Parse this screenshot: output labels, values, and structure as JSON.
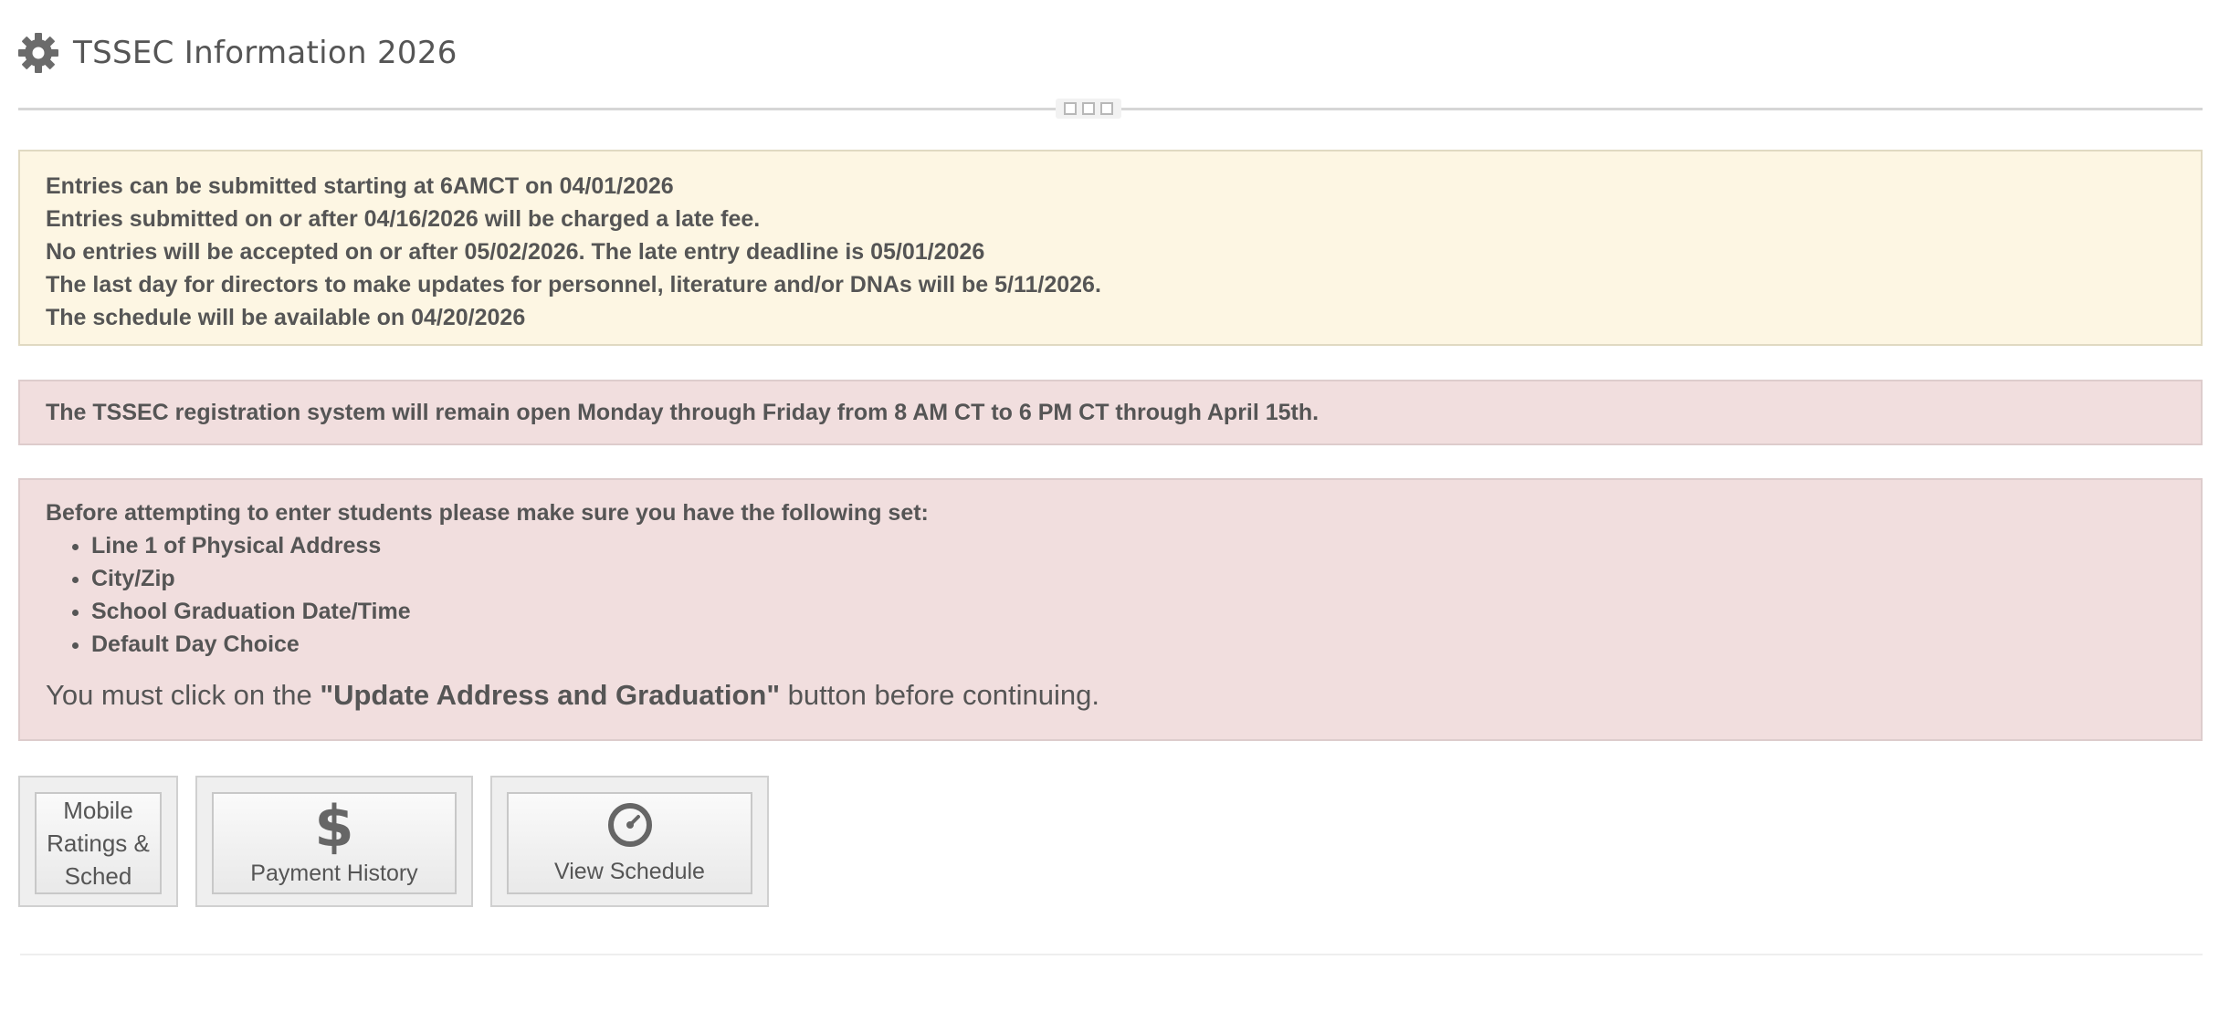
{
  "header": {
    "title": "TSSEC Information 2026",
    "icon": "gear-icon"
  },
  "colors": {
    "warning_bg": "#fdf6e3",
    "danger_bg": "#f1dede",
    "text": "#555555"
  },
  "dates_panel": {
    "lines": [
      "Entries can be submitted starting at 6AMCT on 04/01/2026",
      "Entries submitted on or after 04/16/2026 will be charged a late fee.",
      "No entries will be accepted on or after 05/02/2026. The late entry deadline is 05/01/2026",
      "The last day for directors to make updates for personnel, literature and/or DNAs will be 5/11/2026.",
      "The schedule will be available on 04/20/2026"
    ]
  },
  "hours_panel": {
    "text": "The TSSEC registration system will remain open Monday through Friday from 8 AM CT to 6 PM CT through April 15th."
  },
  "requirements_panel": {
    "intro": "Before attempting to enter students please make sure you have the following set:",
    "items": [
      "Line 1 of Physical Address",
      "City/Zip",
      "School Graduation Date/Time",
      "Default Day Choice"
    ],
    "notice_prefix": "You must click on the ",
    "notice_bold": "\"Update Address and Graduation\"",
    "notice_suffix": " button before continuing."
  },
  "tiles": {
    "mobile": {
      "line1": "Mobile",
      "line2": "Ratings &",
      "line3": "Sched"
    },
    "payment": {
      "icon": "dollar-icon",
      "glyph": "$",
      "label": "Payment History"
    },
    "schedule": {
      "icon": "clock-icon",
      "label": "View Schedule"
    }
  }
}
